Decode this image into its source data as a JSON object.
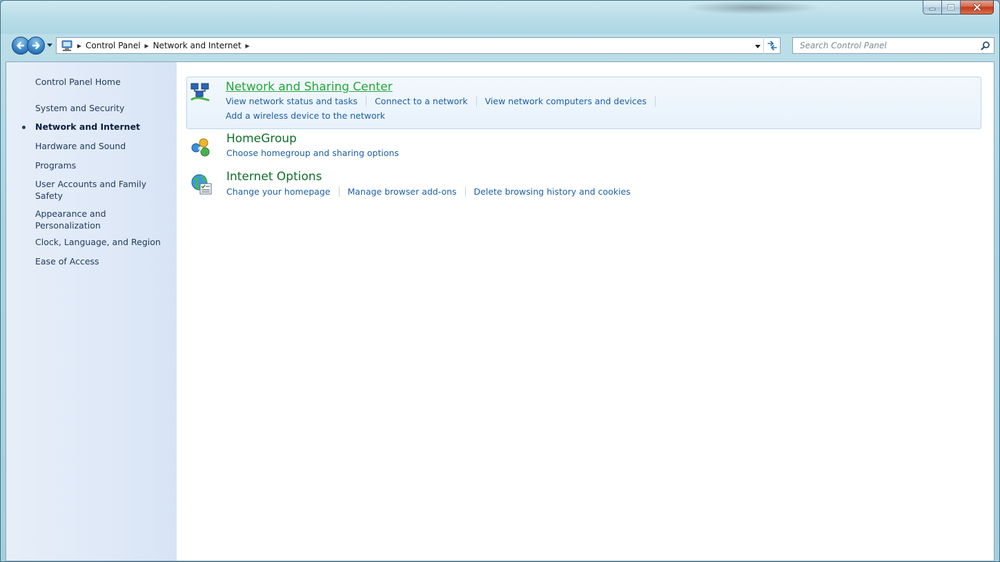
{
  "window": {
    "caption_buttons": {
      "minimize": "minimize-icon",
      "maximize": "maximize-icon",
      "close": "close-icon"
    }
  },
  "navigation": {
    "back_icon": "back-arrow-icon",
    "forward_icon": "forward-arrow-icon",
    "breadcrumb": [
      "Control Panel",
      "Network and Internet"
    ]
  },
  "search": {
    "placeholder": "Search Control Panel",
    "value": ""
  },
  "sidebar": {
    "items": [
      {
        "label": "Control Panel Home",
        "active": false
      },
      {
        "label": "System and Security",
        "active": false
      },
      {
        "label": "Network and Internet",
        "active": true
      },
      {
        "label": "Hardware and Sound",
        "active": false
      },
      {
        "label": "Programs",
        "active": false
      },
      {
        "label": "User Accounts and Family Safety",
        "active": false
      },
      {
        "label": "Appearance and Personalization",
        "active": false
      },
      {
        "label": "Clock, Language, and Region",
        "active": false
      },
      {
        "label": "Ease of Access",
        "active": false
      }
    ]
  },
  "categories": [
    {
      "title": "Network and Sharing Center",
      "icon": "network-sharing-icon",
      "highlighted": true,
      "links": [
        "View network status and tasks",
        "Connect to a network",
        "View network computers and devices",
        "Add a wireless device to the network"
      ]
    },
    {
      "title": "HomeGroup",
      "icon": "homegroup-icon",
      "highlighted": false,
      "links": [
        "Choose homegroup and sharing options"
      ]
    },
    {
      "title": "Internet Options",
      "icon": "internet-options-icon",
      "highlighted": false,
      "links": [
        "Change your homepage",
        "Manage browser add-ons",
        "Delete browsing history and cookies"
      ]
    }
  ],
  "colors": {
    "link": "#1c5fa6",
    "category_title": "#0e6f28",
    "category_title_hover": "#21a838",
    "sidebar_text": "#1e395b"
  }
}
